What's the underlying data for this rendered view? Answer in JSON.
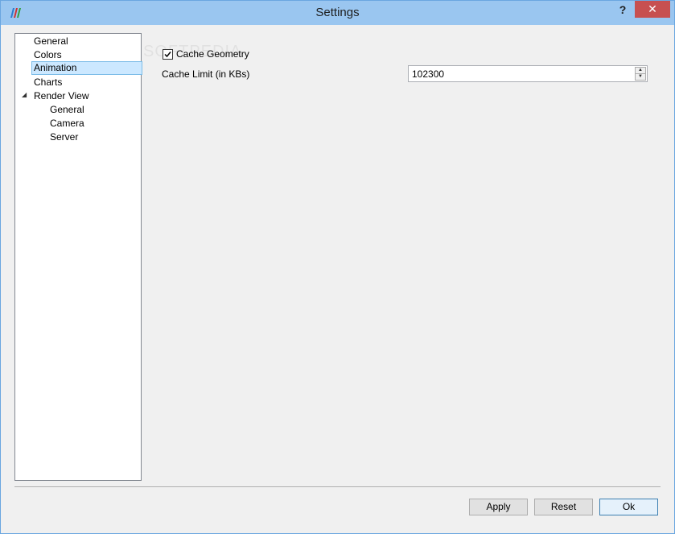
{
  "window": {
    "title": "Settings",
    "help_label": "?",
    "close_label": "✕"
  },
  "colors": {
    "titlebar": "#9ac6f0",
    "close_button": "#c75050",
    "selection": "#cce8ff"
  },
  "tree": {
    "items": [
      {
        "label": "General"
      },
      {
        "label": "Colors"
      },
      {
        "label": "Animation",
        "selected": true
      },
      {
        "label": "Charts"
      },
      {
        "label": "Render View",
        "expanded": true
      },
      {
        "label": "General",
        "child": true
      },
      {
        "label": "Camera",
        "child": true
      },
      {
        "label": "Server",
        "child": true
      }
    ]
  },
  "animation": {
    "cache_geometry_label": "Cache Geometry",
    "cache_geometry_checked": true,
    "cache_limit_label": "Cache Limit (in KBs)",
    "cache_limit_value": "102300"
  },
  "buttons": {
    "apply": "Apply",
    "reset": "Reset",
    "ok": "Ok"
  },
  "watermark": "SOFTPEDIA"
}
